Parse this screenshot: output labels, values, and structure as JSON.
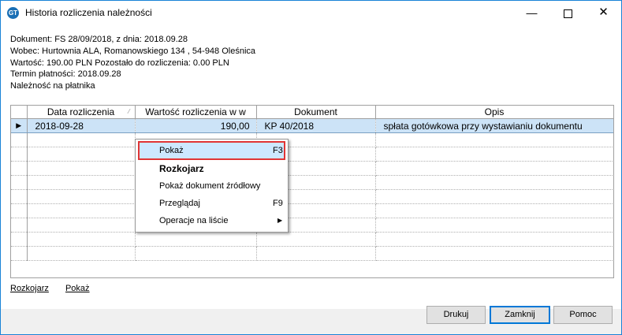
{
  "window": {
    "title": "Historia rozliczenia należności",
    "icon": "app-logo-icon",
    "icon_text": "GT"
  },
  "info": {
    "line1": "Dokument: FS 28/09/2018, z dnia: 2018.09.28",
    "line2": "Wobec: Hurtownia ALA, Romanowskiego 134 , 54-948 Oleśnica",
    "line3": "Wartość: 190.00 PLN Pozostało do rozliczenia: 0.00 PLN",
    "line4": "Termin płatności: 2018.09.28",
    "line5": "Należność na płatnika"
  },
  "grid": {
    "columns": [
      "Data rozliczenia",
      "Wartość rozliczenia w w",
      "Dokument",
      "Opis"
    ],
    "sort_icon": "sort-indicator-icon",
    "rows": [
      {
        "date": "2018-09-28",
        "value": "190,00",
        "document": "KP 40/2018",
        "description": "spłata gotówkowa przy wystawianiu dokumentu",
        "selected": true
      }
    ],
    "row_indicator": "▶"
  },
  "context_menu": {
    "items": [
      {
        "label": "Pokaż",
        "shortcut": "F3",
        "highlighted": true
      },
      {
        "label": "Rozkojarz",
        "shortcut": "",
        "bold": true
      },
      {
        "label": "Pokaż dokument źródłowy",
        "shortcut": ""
      },
      {
        "label": "Przeglądaj",
        "shortcut": "F9"
      },
      {
        "label": "Operacje na liście",
        "shortcut": "",
        "submenu": true
      }
    ]
  },
  "links": {
    "rozkojarz": "Rozkojarz",
    "pokaz": "Pokaż"
  },
  "buttons": {
    "print": "Drukuj",
    "close": "Zamknij",
    "help": "Pomoc"
  },
  "colors": {
    "selected_row": "#cce3f7",
    "menu_highlight": "#cde8ff",
    "highlight_outline": "#e03535",
    "window_border": "#1883d7"
  }
}
